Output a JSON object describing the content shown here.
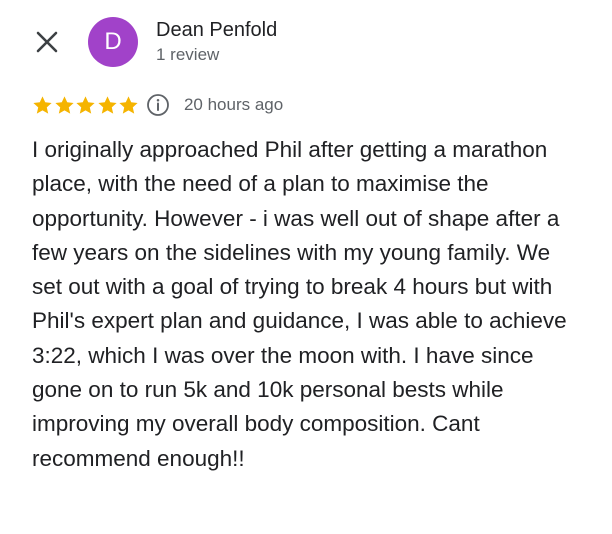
{
  "review": {
    "author": {
      "initial": "D",
      "name": "Dean Penfold",
      "review_count": "1 review",
      "avatar_color": "#a142c9"
    },
    "rating": {
      "stars": 5,
      "max_stars": 5,
      "star_color": "#f5b400",
      "icon": "star-icon",
      "info_icon": "info-icon"
    },
    "time": "20 hours ago",
    "text": "I originally approached Phil after getting a marathon place, with the need of a plan to maximise the opportunity. However - i was well out of shape after a few years on the sidelines with my young family. We set out with a goal of trying to break 4 hours but with Phil's expert plan and guidance, I was able to achieve 3:22, which I was over the moon with. I have since gone on to run 5k and 10k personal bests while improving my overall body composition. Cant recommend enough!!"
  },
  "controls": {
    "close_icon": "close-icon"
  }
}
